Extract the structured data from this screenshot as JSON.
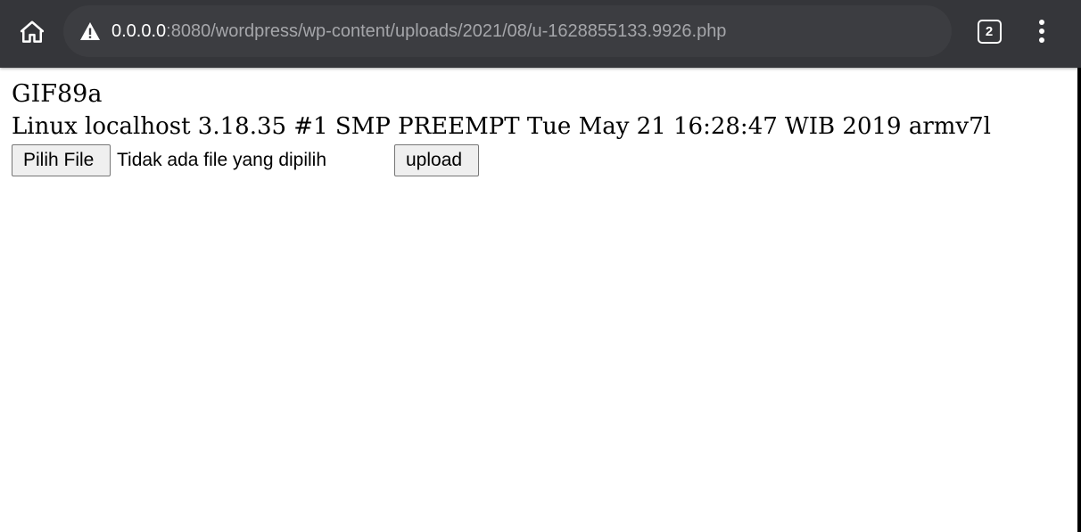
{
  "browser": {
    "url_host": "0.0.0.0",
    "url_path": ":8080/wordpress/wp-content/uploads/2021/08/u-1628855133.9926.php",
    "tab_count": "2",
    "icons": {
      "home": "home-icon",
      "security": "not-secure-warning-icon",
      "tabs": "tab-switcher-icon",
      "menu": "more-vert-icon"
    },
    "colors": {
      "toolbar": "#35363a",
      "omnibox": "#3c3d41",
      "url_host": "#ffffff",
      "url_path": "#a5a6aa"
    }
  },
  "page": {
    "line1": "GIF89a",
    "line2": "Linux localhost 3.18.35 #1 SMP PREEMPT Tue May 21 16:28:47 WIB 2019 armv7l",
    "file_button_label": "Pilih File",
    "file_status": "Tidak ada file yang dipilih",
    "submit_label": "upload"
  }
}
